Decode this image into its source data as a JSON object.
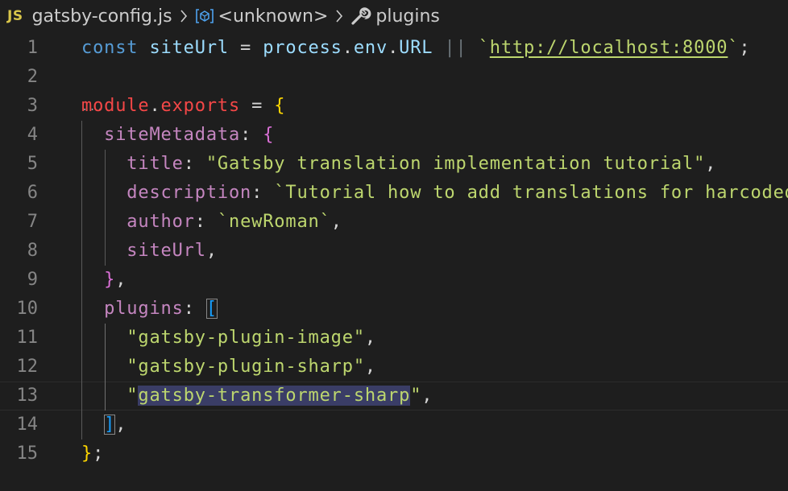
{
  "breadcrumb": {
    "badge": "JS",
    "file": "gatsby-config.js",
    "symbol": "<unknown>",
    "section": "plugins",
    "icons": [
      "chevron-right-icon",
      "object-symbol-icon",
      "wrench-icon"
    ]
  },
  "colors": {
    "background": "#1e1e1e",
    "keyword": "#569cd6",
    "string": "#bdd66e",
    "property": "#c586c0",
    "selection": "#3a3d66"
  },
  "lines": [
    {
      "num": "1",
      "tokens": [
        {
          "t": "const ",
          "c": "kw"
        },
        {
          "t": "siteUrl",
          "c": "var"
        },
        {
          "t": " = ",
          "c": "op"
        },
        {
          "t": "process",
          "c": "var"
        },
        {
          "t": ".",
          "c": "punc"
        },
        {
          "t": "env",
          "c": "var"
        },
        {
          "t": ".",
          "c": "punc"
        },
        {
          "t": "URL",
          "c": "var"
        },
        {
          "t": " || ",
          "c": "op2"
        },
        {
          "t": "`",
          "c": "strg"
        },
        {
          "t": "http://localhost:8000",
          "c": "url"
        },
        {
          "t": "`",
          "c": "strg"
        },
        {
          "t": ";",
          "c": "punc"
        }
      ]
    },
    {
      "num": "2",
      "tokens": []
    },
    {
      "num": "3",
      "tokens": [
        {
          "t": "module",
          "c": "mod"
        },
        {
          "t": ".",
          "c": "punc"
        },
        {
          "t": "exports",
          "c": "mod"
        },
        {
          "t": " = ",
          "c": "op"
        },
        {
          "t": "{",
          "c": "b1"
        }
      ]
    },
    {
      "num": "4",
      "tokens": [
        {
          "t": "  siteMetadata",
          "c": "prop"
        },
        {
          "t": ": ",
          "c": "punc"
        },
        {
          "t": "{",
          "c": "b2"
        }
      ]
    },
    {
      "num": "5",
      "tokens": [
        {
          "t": "    title",
          "c": "prop"
        },
        {
          "t": ": ",
          "c": "punc"
        },
        {
          "t": "\"Gatsby translation implementation tutorial\"",
          "c": "strg"
        },
        {
          "t": ",",
          "c": "punc"
        }
      ]
    },
    {
      "num": "6",
      "tokens": [
        {
          "t": "    description",
          "c": "prop"
        },
        {
          "t": ": ",
          "c": "punc"
        },
        {
          "t": "`Tutorial how to add translations for harcoded",
          "c": "strg"
        }
      ]
    },
    {
      "num": "7",
      "tokens": [
        {
          "t": "    author",
          "c": "prop"
        },
        {
          "t": ": ",
          "c": "punc"
        },
        {
          "t": "`newRoman`",
          "c": "strg"
        },
        {
          "t": ",",
          "c": "punc"
        }
      ]
    },
    {
      "num": "8",
      "tokens": [
        {
          "t": "    siteUrl",
          "c": "prop"
        },
        {
          "t": ",",
          "c": "punc"
        }
      ]
    },
    {
      "num": "9",
      "tokens": [
        {
          "t": "  ",
          "c": "punc"
        },
        {
          "t": "}",
          "c": "b2"
        },
        {
          "t": ",",
          "c": "punc"
        }
      ]
    },
    {
      "num": "10",
      "tokens": [
        {
          "t": "  plugins",
          "c": "prop"
        },
        {
          "t": ": ",
          "c": "punc"
        },
        {
          "t": "[",
          "c": "b3 bracket-box"
        }
      ]
    },
    {
      "num": "11",
      "tokens": [
        {
          "t": "    ",
          "c": "punc"
        },
        {
          "t": "\"gatsby-plugin-image\"",
          "c": "strg"
        },
        {
          "t": ",",
          "c": "punc"
        }
      ]
    },
    {
      "num": "12",
      "tokens": [
        {
          "t": "    ",
          "c": "punc"
        },
        {
          "t": "\"gatsby-plugin-sharp\"",
          "c": "strg"
        },
        {
          "t": ",",
          "c": "punc"
        }
      ]
    },
    {
      "num": "13",
      "tokens": [
        {
          "t": "    \"",
          "c": "strg"
        },
        {
          "t": "gatsby-transformer-sharp",
          "c": "strg sel"
        },
        {
          "t": "\"",
          "c": "strg"
        },
        {
          "t": ",",
          "c": "punc"
        }
      ]
    },
    {
      "num": "14",
      "tokens": [
        {
          "t": "  ",
          "c": "punc"
        },
        {
          "t": "]",
          "c": "b3 bracket-box"
        },
        {
          "t": ",",
          "c": "punc"
        }
      ]
    },
    {
      "num": "15",
      "tokens": [
        {
          "t": "}",
          "c": "b1"
        },
        {
          "t": ";",
          "c": "punc"
        }
      ]
    }
  ]
}
